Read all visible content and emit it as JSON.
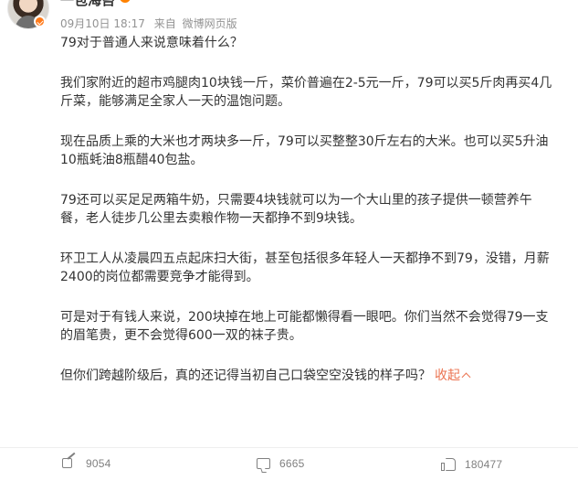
{
  "author": {
    "name": "一包海苔"
  },
  "meta": {
    "time": "09月10日 18:17",
    "source_label": "来自",
    "source": "微博网页版"
  },
  "content": {
    "paragraphs": [
      "79对于普通人来说意味着什么？",
      "我们家附近的超市鸡腿肉10块钱一斤，菜价普遍在2-5元一斤，79可以买5斤肉再买4几斤菜，能够满足全家人一天的温饱问题。",
      "现在品质上乘的大米也才两块多一斤，79可以买整整30斤左右的大米。也可以买5升油10瓶蚝油8瓶醋40包盐。",
      "79还可以买足足两箱牛奶，只需要4块钱就可以为一个大山里的孩子提供一顿营养午餐，老人徒步几公里去卖粮作物一天都挣不到9块钱。",
      "环卫工人从凌晨四五点起床扫大街，甚至包括很多年轻人一天都挣不到79，没错，月薪2400的岗位都需要竞争才能得到。",
      "可是对于有钱人来说，200块掉在地上可能都懒得看一眼吧。你们当然不会觉得79一支的眉笔贵，更不会觉得600一双的袜子贵。"
    ],
    "last_paragraph": "但你们跨越阶级后，真的还记得当初自己口袋空空没钱的样子吗？",
    "collapse_label": "收起"
  },
  "actions": {
    "forward_count": "9054",
    "comment_count": "6665",
    "like_count": "180477"
  },
  "icons": {
    "forward": "forward-icon",
    "comment": "comment-icon",
    "like": "like-icon",
    "collapse": "chevron-up-icon"
  },
  "colors": {
    "text": "#333333",
    "meta": "#939393",
    "accent": "#eb7350",
    "action": "#808080"
  }
}
